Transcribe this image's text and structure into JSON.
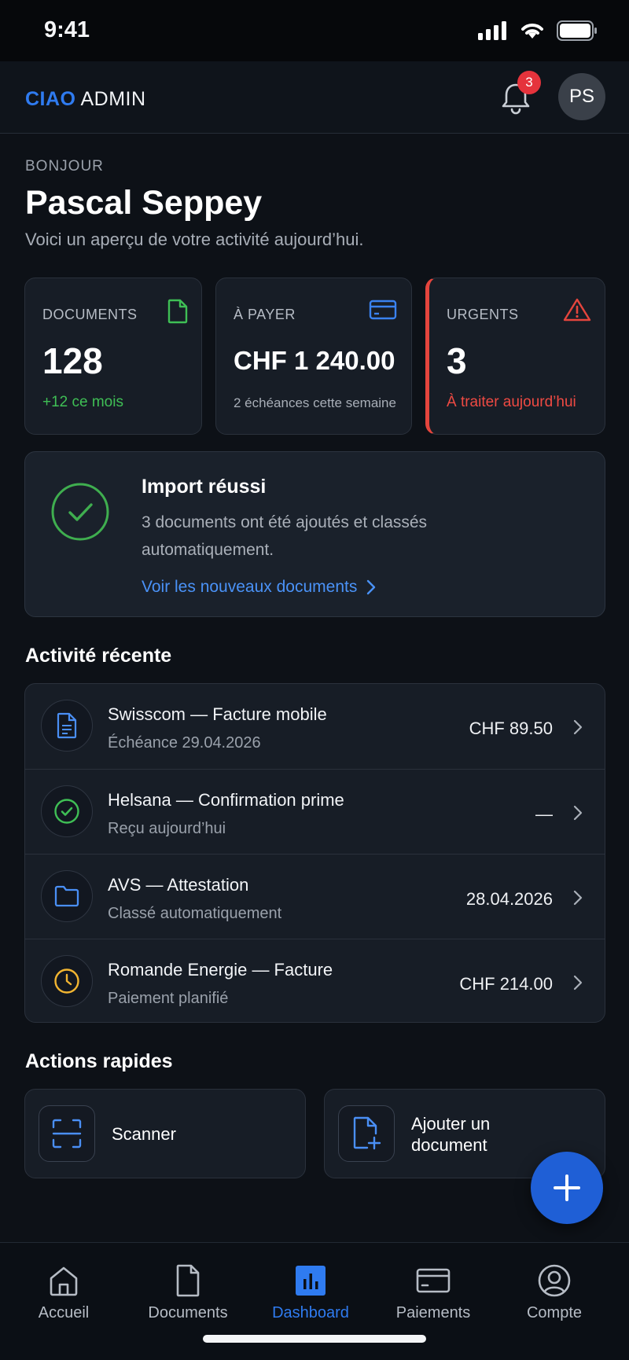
{
  "status_bar": {
    "time": "9:41"
  },
  "header": {
    "brand_accent": "CIAO",
    "brand_rest": "ADMIN",
    "notification_count": "3",
    "avatar_initials": "PS"
  },
  "greeting": {
    "label": "BONJOUR",
    "name": "Pascal Seppey",
    "subtitle": "Voici un aperçu de votre activité aujourd’hui."
  },
  "stats": [
    {
      "label": "DOCUMENTS",
      "value": "128",
      "note": "+12 ce mois",
      "icon": "document-icon",
      "color": "#3fbf55"
    },
    {
      "label": "À PAYER",
      "value": "CHF 1 240.00",
      "note": "2 échéances cette semaine",
      "icon": "credit-card-icon",
      "color": "#3a82f0"
    },
    {
      "label": "URGENTS",
      "value": "3",
      "note": "À traiter aujourd’hui",
      "icon": "warning-icon",
      "color": "#e5453d"
    }
  ],
  "import_banner": {
    "title": "Import réussi",
    "text": "3 documents ont été ajoutés et classés automatiquement.",
    "link": "Voir les nouveaux documents",
    "icon": "check-circle-icon"
  },
  "activity": {
    "title": "Activité récente",
    "items": [
      {
        "title": "Swisscom — Facture mobile",
        "subtitle": "Échéance 29.04.2026",
        "value": "CHF 89.50",
        "icon": "file-text-icon"
      },
      {
        "title": "Helsana — Confirmation prime",
        "subtitle": "Reçu aujourd’hui",
        "value": "—",
        "icon": "check-circle-icon"
      },
      {
        "title": "AVS — Attestation",
        "subtitle": "Classé automatiquement",
        "value": "28.04.2026",
        "icon": "folder-icon"
      },
      {
        "title": "Romande Energie — Facture",
        "subtitle": "Paiement planifié",
        "value": "CHF 214.00",
        "icon": "clock-icon"
      }
    ]
  },
  "quick_actions": {
    "title": "Actions rapides",
    "items": [
      {
        "label": "Scanner",
        "icon": "scan-icon"
      },
      {
        "label": "Ajouter un document",
        "label_line1": "Ajouter un",
        "label_line2": "document",
        "icon": "file-plus-icon"
      }
    ]
  },
  "fab": {
    "icon": "plus-icon"
  },
  "nav": {
    "active": "Dashboard",
    "items": [
      {
        "label": "Accueil",
        "icon": "home-icon"
      },
      {
        "label": "Documents",
        "icon": "document-icon"
      },
      {
        "label": "Dashboard",
        "icon": "bar-chart-icon"
      },
      {
        "label": "Paiements",
        "icon": "credit-card-icon"
      },
      {
        "label": "Compte",
        "icon": "user-circle-icon"
      }
    ]
  },
  "colors": {
    "accent": "#2f7bf0",
    "success": "#3fbf55",
    "danger": "#e5453d",
    "warning": "#f2b531",
    "background": "#0d1117"
  }
}
